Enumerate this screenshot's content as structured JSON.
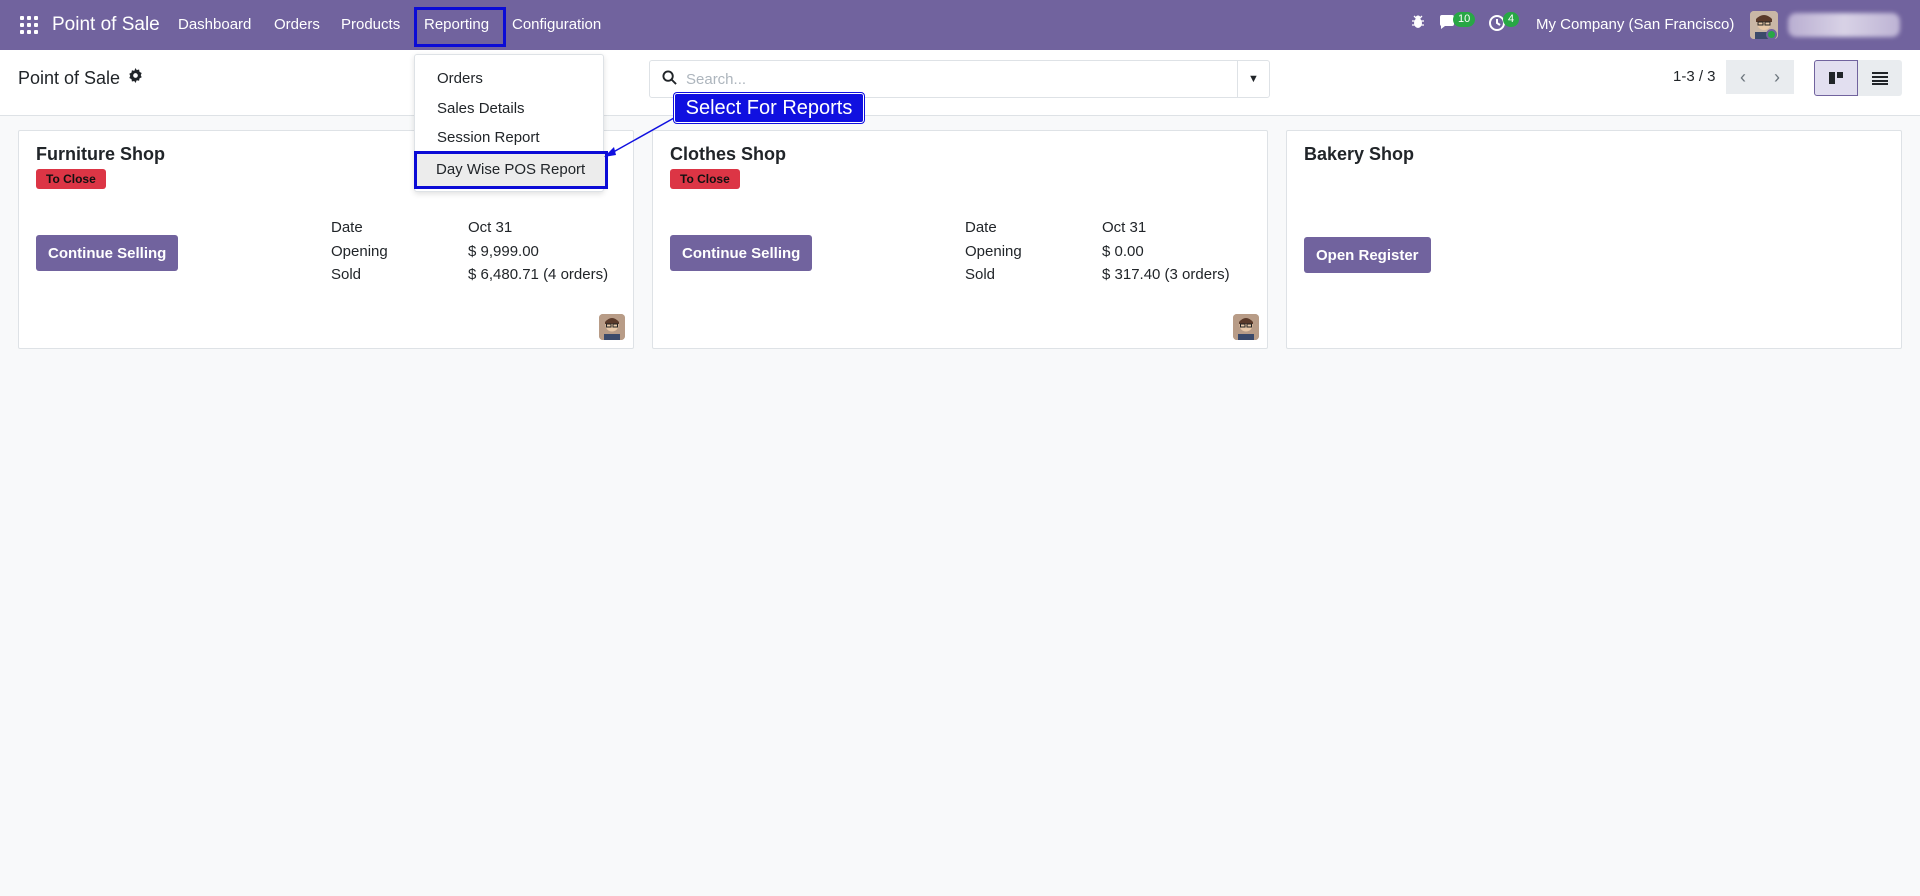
{
  "navbar": {
    "brand": "Point of Sale",
    "menu": [
      "Dashboard",
      "Orders",
      "Products",
      "Reporting",
      "Configuration"
    ],
    "messages_count": "10",
    "activities_count": "4",
    "company": "My Company (San Francisco)"
  },
  "control_panel": {
    "title": "Point of Sale",
    "search_placeholder": "Search...",
    "pager": "1-3 / 3"
  },
  "reporting_dropdown": {
    "items": [
      "Orders",
      "Sales Details",
      "Session Report",
      "Day Wise POS Report"
    ],
    "highlighted": "Day Wise POS Report"
  },
  "annotation": {
    "callout": "Select For Reports",
    "color": "#1010e0"
  },
  "cards": [
    {
      "title": "Furniture Shop",
      "status": "To Close",
      "button": "Continue Selling",
      "date_label": "Date",
      "date": "Oct 31",
      "opening_label": "Opening",
      "opening": "$ 9,999.00",
      "sold_label": "Sold",
      "sold": "$ 6,480.71 (4 orders)"
    },
    {
      "title": "Clothes Shop",
      "status": "To Close",
      "button": "Continue Selling",
      "date_label": "Date",
      "date": "Oct 31",
      "opening_label": "Opening",
      "opening": "$ 0.00",
      "sold_label": "Sold",
      "sold": "$ 317.40 (3 orders)"
    },
    {
      "title": "Bakery Shop",
      "button": "Open Register"
    }
  ],
  "colors": {
    "navbar": "#71639e",
    "primary": "#71639e",
    "danger": "#dc3545",
    "success": "#28a745",
    "highlight_border": "#0b0bd6"
  }
}
